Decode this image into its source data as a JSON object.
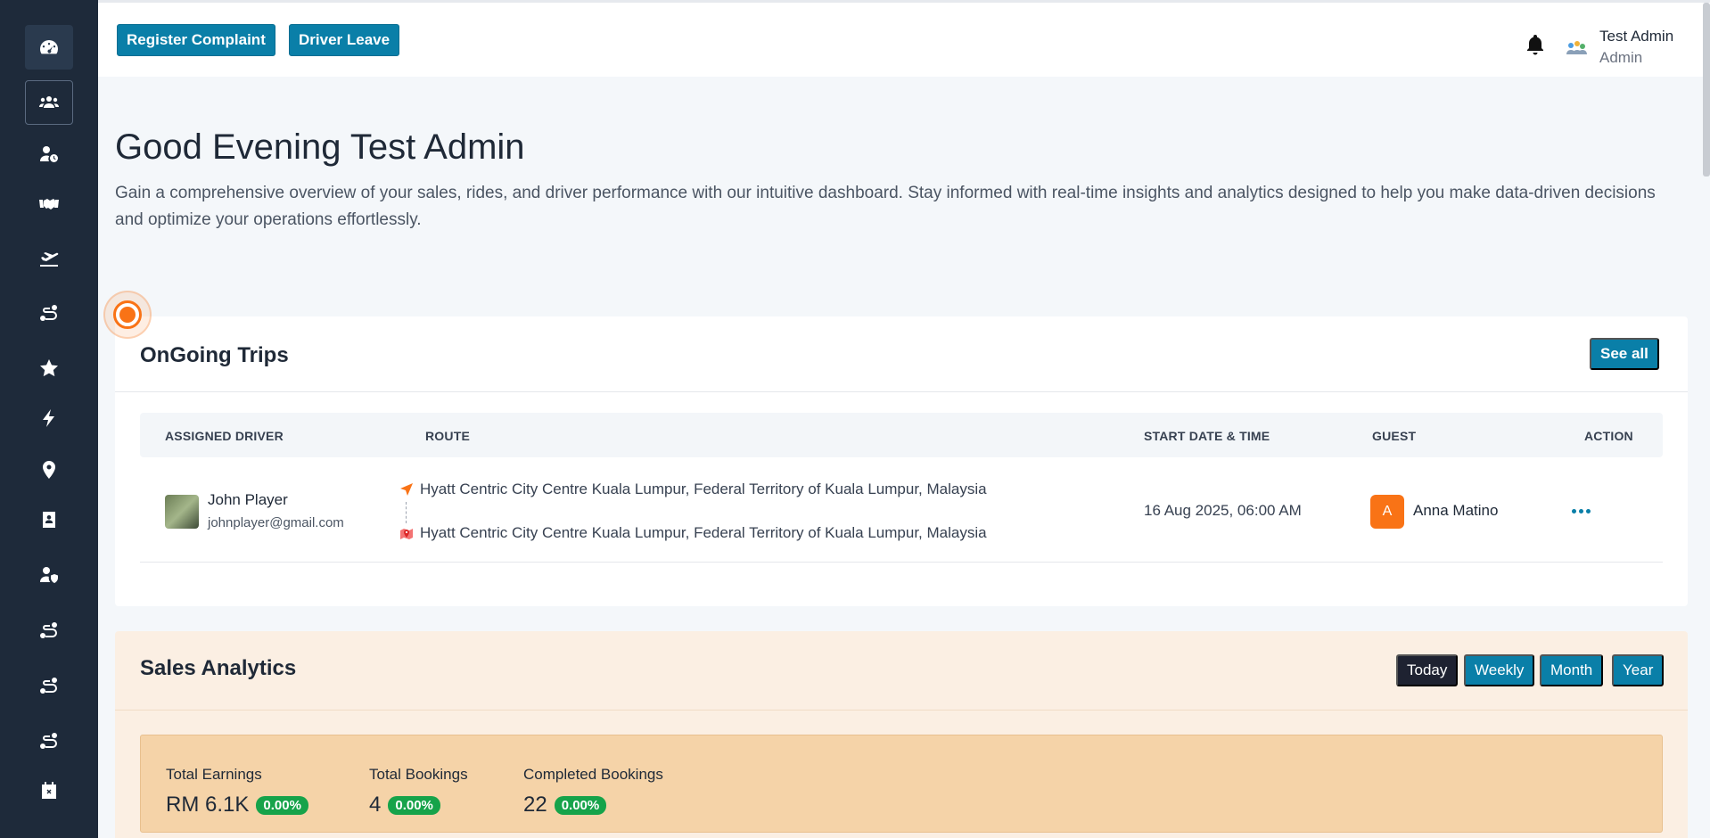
{
  "sidebar": {
    "items": [
      {
        "icon": "speedometer-icon"
      },
      {
        "icon": "users-icon"
      },
      {
        "icon": "user-clock-icon"
      },
      {
        "icon": "handshake-icon"
      },
      {
        "icon": "plane-departure-icon"
      },
      {
        "icon": "route-icon"
      },
      {
        "icon": "star-icon"
      },
      {
        "icon": "bolt-icon"
      },
      {
        "icon": "map-pin-icon"
      },
      {
        "icon": "id-badge-icon"
      },
      {
        "icon": "user-shield-icon"
      },
      {
        "icon": "route-icon"
      },
      {
        "icon": "route-icon"
      },
      {
        "icon": "route-icon"
      },
      {
        "icon": "calendar-x-icon"
      }
    ]
  },
  "header": {
    "register_complaint": "Register Complaint",
    "driver_leave": "Driver Leave",
    "user_name": "Test Admin",
    "user_role": "Admin"
  },
  "page": {
    "greeting": "Good Evening Test Admin",
    "intro": "Gain a comprehensive overview of your sales, rides, and driver performance with our intuitive dashboard. Stay informed with real-time insights and analytics designed to help you make data-driven decisions and optimize your operations effortlessly."
  },
  "trips": {
    "title": "OnGoing Trips",
    "see_all": "See all",
    "columns": {
      "driver": "ASSIGNED DRIVER",
      "route": "ROUTE",
      "start": "START DATE & TIME",
      "guest": "GUEST",
      "action": "ACTION"
    },
    "rows": [
      {
        "driver_name": "John Player",
        "driver_email": "johnplayer@gmail.com",
        "pickup": "Hyatt Centric City Centre Kuala Lumpur, Federal Territory of Kuala Lumpur, Malaysia",
        "dropoff": "Hyatt Centric City Centre Kuala Lumpur, Federal Territory of Kuala Lumpur, Malaysia",
        "start": "16 Aug 2025, 06:00 AM",
        "guest_initial": "A",
        "guest_name": "Anna Matino"
      }
    ]
  },
  "sales": {
    "title": "Sales Analytics",
    "ranges": [
      "Today",
      "Weekly",
      "Month",
      "Year"
    ],
    "active_range": "Today",
    "stats": [
      {
        "label": "Total Earnings",
        "value": "RM 6.1K",
        "change": "0.00%"
      },
      {
        "label": "Total Bookings",
        "value": "4",
        "change": "0.00%"
      },
      {
        "label": "Completed Bookings",
        "value": "22",
        "change": "0.00%"
      }
    ]
  },
  "colors": {
    "sidebar": "#1e2a3a",
    "primary": "#0a7fa8",
    "accent": "#f97316",
    "success": "#16a34a"
  }
}
